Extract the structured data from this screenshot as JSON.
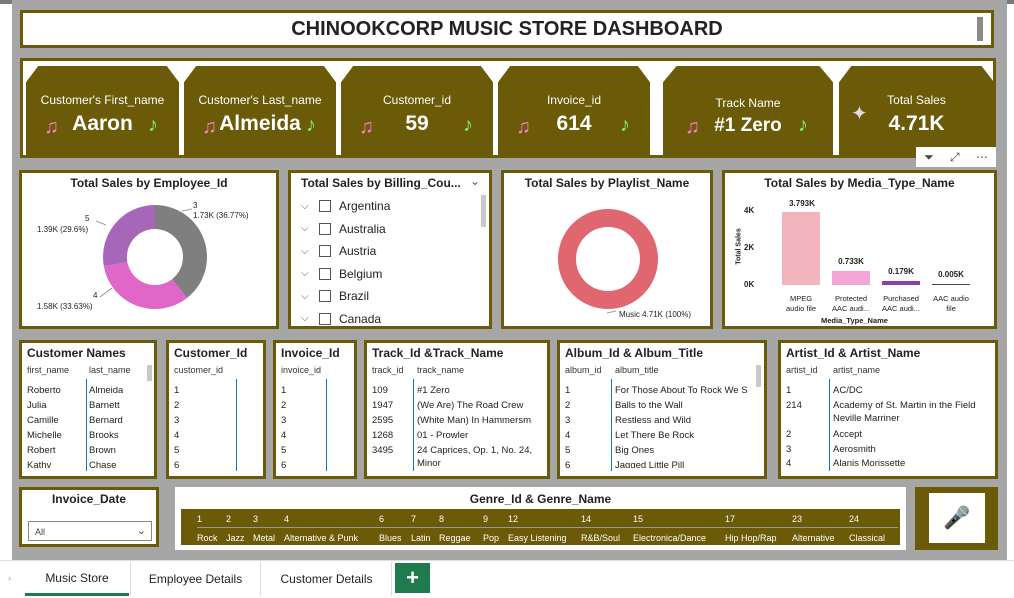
{
  "header": {
    "title": "CHINOOKCORP MUSIC STORE DASHBOARD"
  },
  "kpis": [
    {
      "label": "Customer's First_name",
      "value": "Aaron"
    },
    {
      "label": "Customer's Last_name",
      "value": "Almeida"
    },
    {
      "label": "Customer_id",
      "value": "59"
    },
    {
      "label": "Invoice_id",
      "value": "614"
    },
    {
      "label": "Track Name",
      "value": "#1 Zero"
    },
    {
      "label": "Total Sales",
      "value": "4.71K"
    }
  ],
  "visual_toolbar": {
    "icons": [
      "filter-icon",
      "focus-mode-icon",
      "more-options-icon"
    ]
  },
  "employee_chart": {
    "title": "Total Sales by Employee_Id",
    "labels": {
      "3": "3",
      "3v": "1.73K (36.77%)",
      "4": "4",
      "4v": "1.58K (33.63%)",
      "5": "5",
      "5v": "1.39K (29.6%)"
    }
  },
  "billing_slicer": {
    "title": "Total Sales by Billing_Cou...",
    "items": [
      "Argentina",
      "Australia",
      "Austria",
      "Belgium",
      "Brazil",
      "Canada"
    ]
  },
  "playlist_chart": {
    "title": "Total Sales by Playlist_Name",
    "label": "Music 4.71K (100%)"
  },
  "media_chart": {
    "title": "Total Sales by Media_Type_Name",
    "ylabel": "Total Sales",
    "xlabel": "Media_Type_Name",
    "ticks": [
      "4K",
      "2K",
      "0K"
    ],
    "data_labels": [
      "3.793K",
      "0.733K",
      "0.179K",
      "0.005K"
    ],
    "cat_lines": [
      [
        "MPEG",
        "audio file"
      ],
      [
        "Protected",
        "AAC audi..."
      ],
      [
        "Purchased",
        "AAC audi..."
      ],
      [
        "AAC audio",
        "file"
      ]
    ]
  },
  "customer_names": {
    "title": "Customer Names",
    "headers": [
      "first_name",
      "last_name"
    ],
    "rows": [
      [
        "Roberto",
        "Almeida"
      ],
      [
        "Julia",
        "Barnett"
      ],
      [
        "Camille",
        "Bernard"
      ],
      [
        "Michelle",
        "Brooks"
      ],
      [
        "Robert",
        "Brown"
      ],
      [
        "Kathy",
        "Chase"
      ]
    ]
  },
  "customer_ids": {
    "title": "Customer_Id",
    "header": "customer_id",
    "rows": [
      "1",
      "2",
      "3",
      "4",
      "5",
      "6"
    ]
  },
  "invoice_ids": {
    "title": "Invoice_Id",
    "header": "invoice_id",
    "rows": [
      "1",
      "2",
      "3",
      "4",
      "5",
      "6"
    ]
  },
  "tracks": {
    "title": "Track_Id &Track_Name",
    "headers": [
      "track_id",
      "track_name"
    ],
    "rows": [
      [
        "109",
        "#1 Zero"
      ],
      [
        "1947",
        "(We Are) The Road Crew"
      ],
      [
        "2595",
        "(White Man) In Hammersm"
      ],
      [
        "1268",
        "01 - Prowler"
      ],
      [
        "3495",
        "24 Caprices, Op. 1, No. 24,"
      ],
      [
        "",
        "Minor"
      ]
    ]
  },
  "albums": {
    "title": "Album_Id & Album_Title",
    "headers": [
      "album_id",
      "album_title"
    ],
    "rows": [
      [
        "1",
        "For Those About To Rock We S"
      ],
      [
        "2",
        "Balls to the Wall"
      ],
      [
        "3",
        "Restless and Wild"
      ],
      [
        "4",
        "Let There Be Rock"
      ],
      [
        "5",
        "Big Ones"
      ],
      [
        "6",
        "Jagged Little Pill"
      ]
    ]
  },
  "artists": {
    "title": "Artist_Id & Artist_Name",
    "headers": [
      "artist_id",
      "artist_name"
    ],
    "rows": [
      [
        "1",
        "AC/DC"
      ],
      [
        "214",
        "Academy of St. Martin in the Field"
      ],
      [
        "",
        "Neville Marriner"
      ],
      [
        "2",
        "Accept"
      ],
      [
        "3",
        "Aerosmith"
      ],
      [
        "4",
        "Alanis Morissette"
      ]
    ]
  },
  "invoice_date": {
    "title": "Invoice_Date",
    "selected": "All"
  },
  "genres": {
    "title": "Genre_Id & Genre_Name",
    "ids": [
      "1",
      "2",
      "3",
      "4",
      "6",
      "7",
      "8",
      "9",
      "12",
      "14",
      "15",
      "17",
      "23",
      "24"
    ],
    "names": [
      "Rock",
      "Jazz",
      "Metal",
      "Alternative & Punk",
      "Blues",
      "Latin",
      "Reggae",
      "Pop",
      "Easy Listening",
      "R&B/Soul",
      "Electronica/Dance",
      "Hip Hop/Rap",
      "Alternative",
      "Classical"
    ]
  },
  "tabs": [
    "Music Store",
    "Employee Details",
    "Customer Details"
  ],
  "add_tab": "+"
}
